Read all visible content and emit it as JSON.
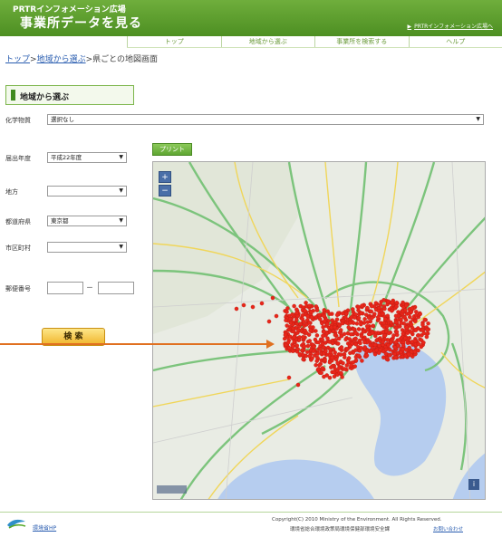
{
  "header": {
    "site_name": "PRTRインフォメーション広場",
    "subtitle": "事業所データを見る",
    "right_link": "PRTRインフォメーション広場へ"
  },
  "nav": {
    "items": [
      "トップ",
      "地域から選ぶ",
      "事業所を検索する",
      "ヘルプ"
    ]
  },
  "breadcrumb": {
    "top": "トップ",
    "region": "地域から選ぶ",
    "separator": ">",
    "current": "県ごとの地図画面"
  },
  "section": {
    "title": "地域から選ぶ"
  },
  "form": {
    "chemical_label": "化学物質",
    "chemical_value": "選択なし",
    "year_label": "届出年度",
    "year_value": "平成22年度",
    "region_label": "地方",
    "region_value": "",
    "prefecture_label": "都道府県",
    "prefecture_value": "東京都",
    "city_label": "市区町村",
    "city_value": "",
    "postal_label": "郵便番号",
    "postal_dash": "－",
    "search_label": "検 索",
    "print_label": "プリント"
  },
  "map": {
    "zoom_in": "+",
    "zoom_out": "−",
    "info": "i",
    "colors": {
      "background": "#e9ece4",
      "water": "#b6cdef",
      "green_road": "#7cc47c",
      "yellow_road": "#f0d65a",
      "marker": "#e8261a"
    }
  },
  "footer": {
    "left_link": "環境省HP",
    "copyright": "Copyright(C) 2010 Ministry of the Environment. All Rights Reserved.",
    "org": "環境省総合環境政策局環境保健部環境安全課",
    "contact": "お問い合わせ"
  },
  "colors": {
    "brand_green": "#5a9a2c",
    "annotation_arrow": "#e07020",
    "button_yellow": "#f0b429"
  }
}
